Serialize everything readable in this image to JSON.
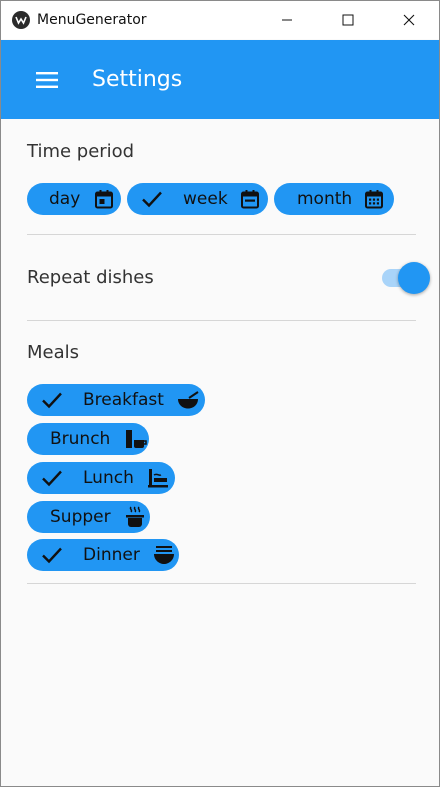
{
  "window": {
    "title": "MenuGenerator",
    "controls": [
      "minimize",
      "maximize",
      "close"
    ]
  },
  "appbar": {
    "title": "Settings",
    "menu_icon": "hamburger-menu-icon",
    "color": "#2196f3"
  },
  "time_period": {
    "title": "Time period",
    "chips": [
      {
        "label": "day",
        "selected": false,
        "icon": "calendar-today-icon"
      },
      {
        "label": "week",
        "selected": true,
        "icon": "calendar-week-icon"
      },
      {
        "label": "month",
        "selected": false,
        "icon": "calendar-month-icon"
      }
    ]
  },
  "repeat": {
    "label": "Repeat dishes",
    "enabled": true
  },
  "meals": {
    "title": "Meals",
    "chips": [
      {
        "label": "Breakfast",
        "selected": true,
        "icon": "bowl-icon"
      },
      {
        "label": "Brunch",
        "selected": false,
        "icon": "glass-mug-icon"
      },
      {
        "label": "Lunch",
        "selected": true,
        "icon": "lunch-tray-icon"
      },
      {
        "label": "Supper",
        "selected": false,
        "icon": "hot-pot-icon"
      },
      {
        "label": "Dinner",
        "selected": true,
        "icon": "noodle-bowl-icon"
      }
    ]
  }
}
